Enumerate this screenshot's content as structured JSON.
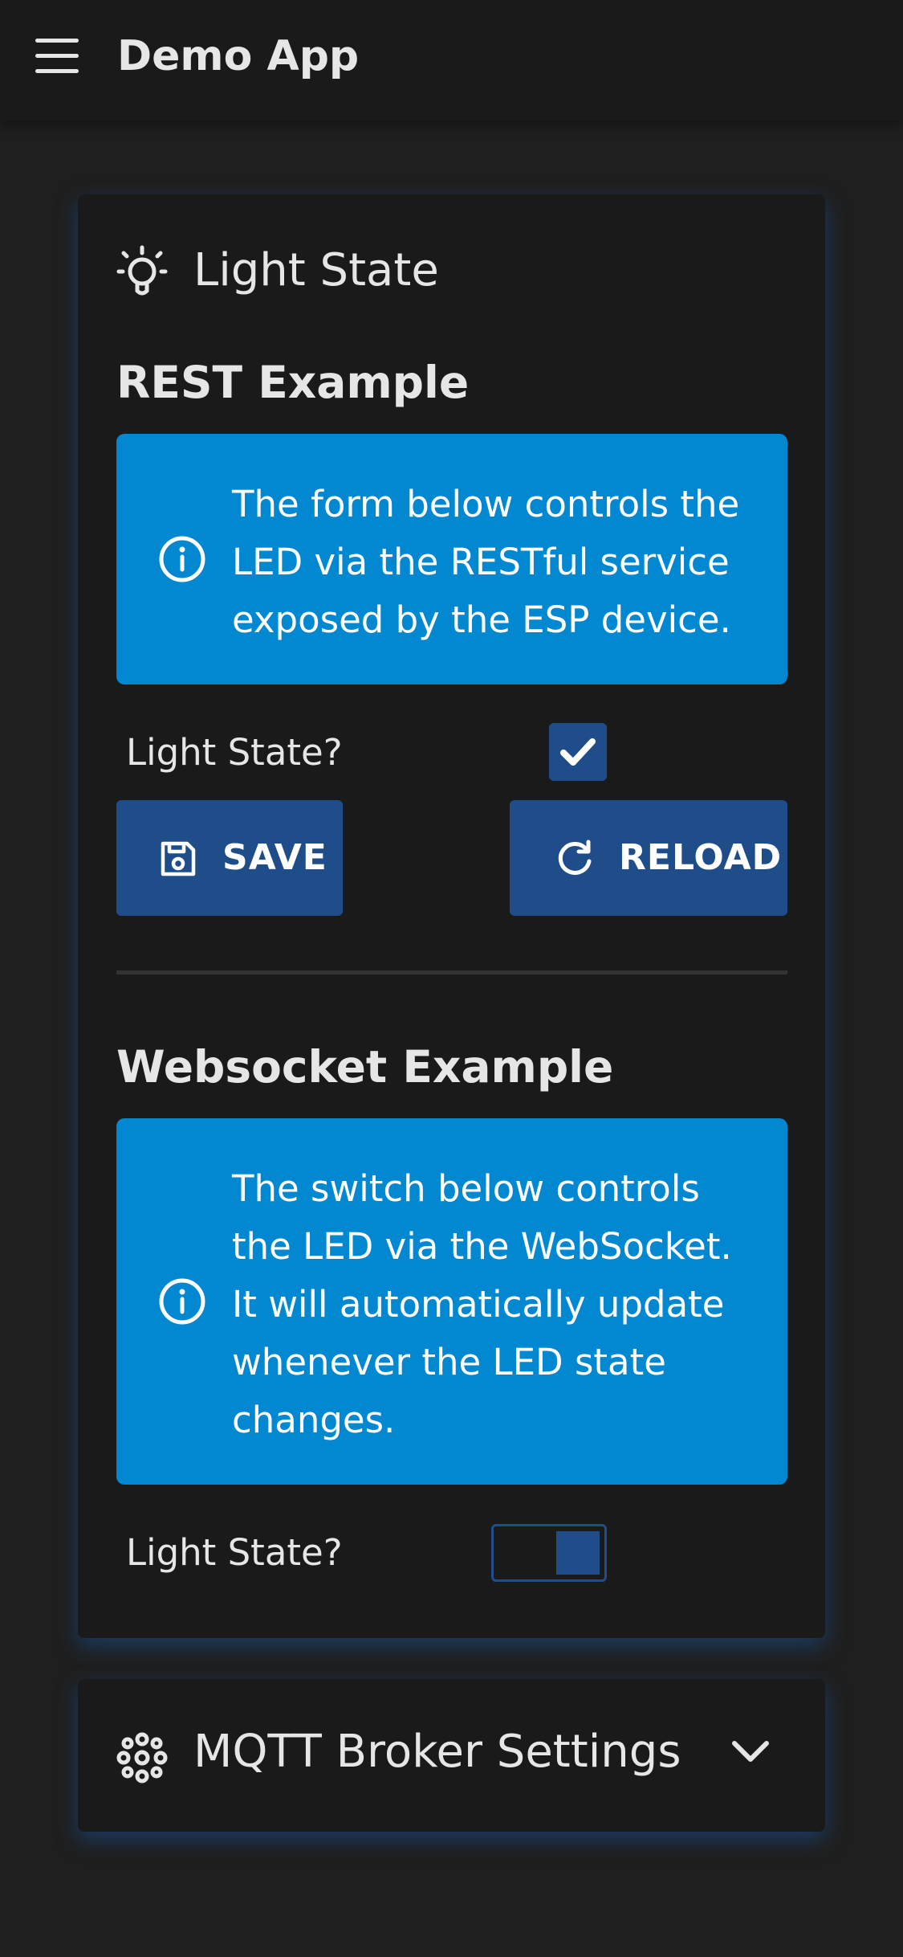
{
  "appbar": {
    "title": "Demo App",
    "menu_icon": "menu-icon"
  },
  "light_card": {
    "title": "Light State",
    "icon": "lightbulb-icon",
    "rest": {
      "heading": "REST Example",
      "info": "The form below controls the LED via the RESTful service exposed by the ESP device.",
      "field_label": "Light State?",
      "checked": true,
      "save_label": "SAVE",
      "reload_label": "RELOAD"
    },
    "websocket": {
      "heading": "Websocket Example",
      "info": "The switch below controls the LED via the WebSocket. It will automatically update whenever the LED state changes.",
      "field_label": "Light State?",
      "switch_on": true
    }
  },
  "mqtt_card": {
    "title": "MQTT Broker Settings",
    "icon": "settings-input-antenna-icon",
    "expand_icon": "chevron-down-icon"
  },
  "colors": {
    "background": "#1f1f1f",
    "surface": "#1a1a1a",
    "info": "#0288d1",
    "primary": "#1e4d8a",
    "text": "#e6e6e6"
  }
}
